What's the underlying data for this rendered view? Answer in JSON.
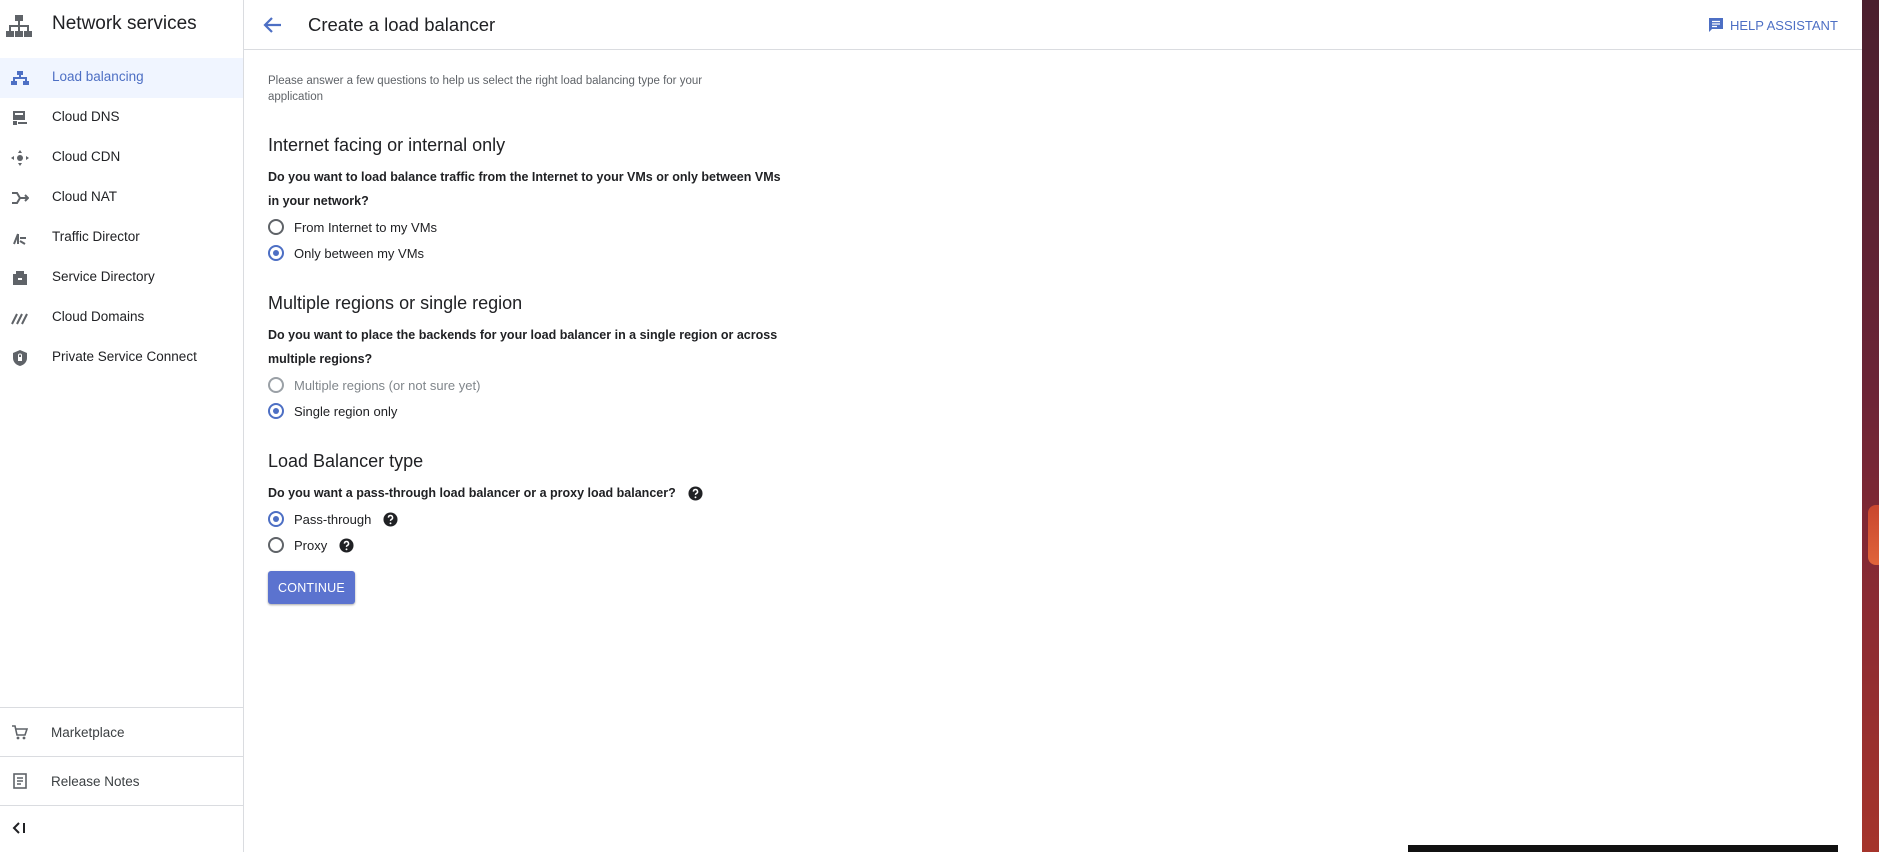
{
  "sidebar": {
    "title": "Network services",
    "items": [
      {
        "label": "Load balancing",
        "icon": "load-balancing-icon",
        "active": true
      },
      {
        "label": "Cloud DNS",
        "icon": "cloud-dns-icon"
      },
      {
        "label": "Cloud CDN",
        "icon": "cloud-cdn-icon"
      },
      {
        "label": "Cloud NAT",
        "icon": "cloud-nat-icon"
      },
      {
        "label": "Traffic Director",
        "icon": "traffic-director-icon"
      },
      {
        "label": "Service Directory",
        "icon": "service-directory-icon"
      },
      {
        "label": "Cloud Domains",
        "icon": "cloud-domains-icon"
      },
      {
        "label": "Private Service Connect",
        "icon": "private-service-connect-icon"
      }
    ],
    "bottom": {
      "marketplace": "Marketplace",
      "release_notes": "Release Notes"
    }
  },
  "header": {
    "title": "Create a load balancer",
    "help_label": "HELP ASSISTANT"
  },
  "main": {
    "intro": "Please answer a few questions to help us select the right load balancing type for your application",
    "sections": [
      {
        "title": "Internet facing or internal only",
        "question": "Do you want to load balance traffic from the Internet to your VMs or only between VMs in your network?",
        "options": [
          {
            "label": "From Internet to my VMs",
            "checked": false
          },
          {
            "label": "Only between my VMs",
            "checked": true
          }
        ]
      },
      {
        "title": "Multiple regions or single region",
        "question": "Do you want to place the backends for your load balancer in a single region or across multiple regions?",
        "options": [
          {
            "label": "Multiple regions (or not sure yet)",
            "checked": false,
            "disabled": true
          },
          {
            "label": "Single region only",
            "checked": true
          }
        ]
      },
      {
        "title": "Load Balancer type",
        "question": "Do you want a pass-through load balancer or a proxy load balancer?",
        "options": [
          {
            "label": "Pass-through",
            "checked": true
          },
          {
            "label": "Proxy",
            "checked": false
          }
        ]
      }
    ],
    "continue_label": "CONTINUE"
  },
  "colors": {
    "accent": "#4d6fc4",
    "button": "#5b73cf",
    "active_nav_bg": "#f0f5ff"
  }
}
